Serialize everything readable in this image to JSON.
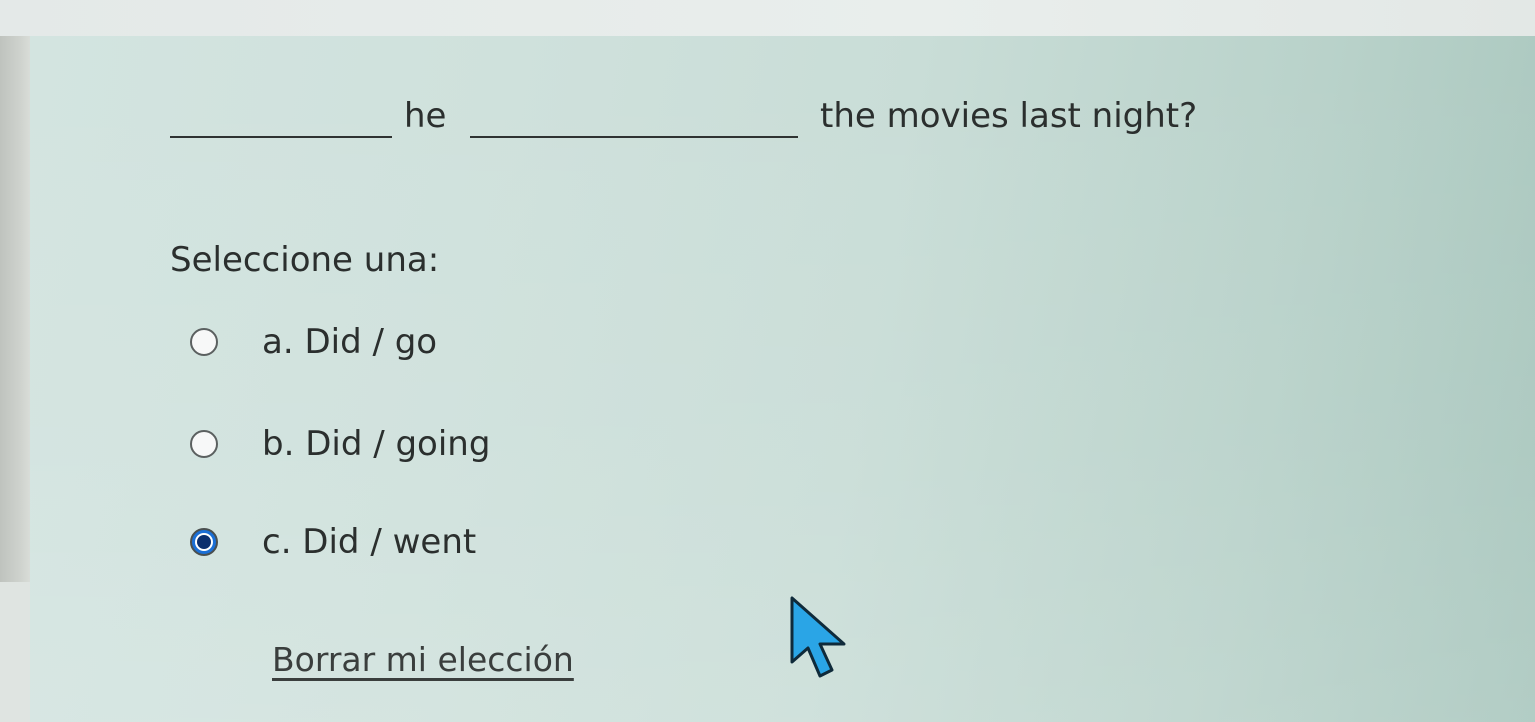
{
  "question": {
    "word_he": "he",
    "rest": "the movies last night?"
  },
  "prompt": "Seleccione una:",
  "options": [
    {
      "text": "a. Did / go",
      "selected": false
    },
    {
      "text": "b. Did / going",
      "selected": false
    },
    {
      "text": "c. Did / went",
      "selected": true
    }
  ],
  "clear_link": "Borrar mi elección",
  "colors": {
    "panel_bg": "#cfe1dc",
    "text": "#2b2f2e",
    "radio_selected": "#1b6fd6",
    "cursor_fill": "#2aa5e6"
  },
  "icons": {
    "cursor": "mouse-pointer-icon"
  }
}
